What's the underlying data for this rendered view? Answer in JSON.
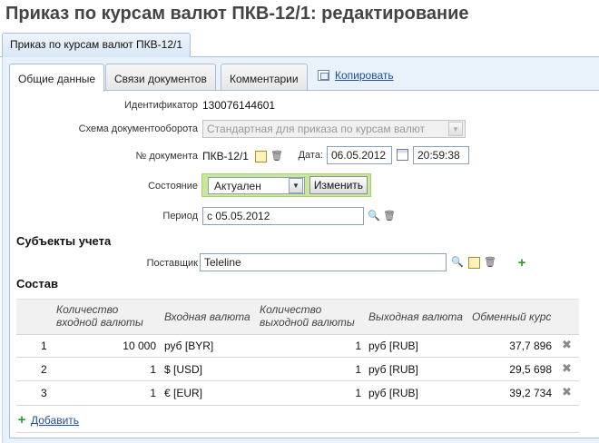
{
  "page_title": "Приказ по курсам валют ПКВ-12/1: редактирование",
  "outer_tab": "Приказ по курсам валют ПКВ-12/1",
  "tabs": [
    {
      "label": "Общие данные",
      "active": true
    },
    {
      "label": "Связи документов",
      "active": false
    },
    {
      "label": "Комментарии",
      "active": false
    }
  ],
  "copy_label": "Копировать",
  "form": {
    "identifier": {
      "label": "Идентификатор",
      "value": "130076144601"
    },
    "workflow": {
      "label": "Схема документооборота",
      "value": "Стандартная для приказа по курсам валют"
    },
    "doc_number": {
      "label": "№ документа",
      "value": "ПКВ-12/1"
    },
    "date": {
      "label": "Дата:",
      "value": "06.05.2012",
      "time": "20:59:38"
    },
    "state": {
      "label": "Состояние",
      "value": "Актуален",
      "button": "Изменить"
    },
    "period": {
      "label": "Период",
      "value": "с 05.05.2012"
    }
  },
  "subjects": {
    "title": "Субъекты учета",
    "supplier_label": "Поставщик",
    "supplier_value": "Teleline"
  },
  "composition": {
    "title": "Состав",
    "headers": {
      "qty_in": "Количество входной валюты",
      "cur_in": "Входная валюта",
      "qty_out": "Количество выходной валюты",
      "cur_out": "Выходная валюта",
      "rate": "Обменный курс"
    },
    "rows": [
      {
        "n": "1",
        "qty_in": "10 000",
        "cur_in": "руб [BYR]",
        "qty_out": "1",
        "cur_out": "руб [RUB]",
        "rate": "37,7 896"
      },
      {
        "n": "2",
        "qty_in": "1",
        "cur_in": "$ [USD]",
        "qty_out": "1",
        "cur_out": "руб [RUB]",
        "rate": "29,5 698"
      },
      {
        "n": "3",
        "qty_in": "1",
        "cur_in": "€ [EUR]",
        "qty_out": "1",
        "cur_out": "руб [RUB]",
        "rate": "39,2 734"
      }
    ],
    "add_label": "Добавить"
  }
}
